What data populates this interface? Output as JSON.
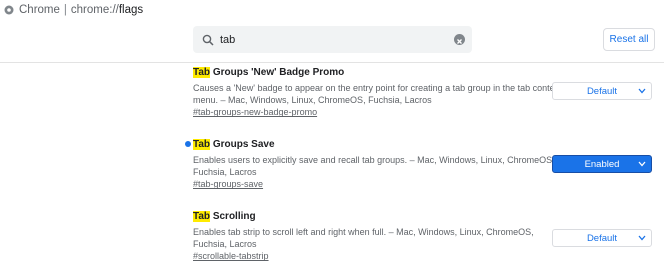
{
  "addressbar": {
    "browser": "Chrome",
    "separator": "|",
    "url_scheme": "chrome://",
    "url_path": "flags"
  },
  "search": {
    "value": "tab"
  },
  "reset_all_label": "Reset all",
  "flags": [
    {
      "highlight": "Tab",
      "title_rest": " Groups 'New' Badge Promo",
      "description": "Causes a 'New' badge to appear on the entry point for creating a tab group in the tab context menu. – Mac, Windows, Linux, ChromeOS, Fuchsia, Lacros",
      "link": "#tab-groups-new-badge-promo",
      "state": "Default"
    },
    {
      "highlight": "Tab",
      "title_rest": " Groups Save",
      "description": "Enables users to explicitly save and recall tab groups. – Mac, Windows, Linux, ChromeOS, Fuchsia, Lacros",
      "link": "#tab-groups-save",
      "state": "Enabled"
    },
    {
      "highlight": "Tab",
      "title_rest": " Scrolling",
      "description": "Enables tab strip to scroll left and right when full. – Mac, Windows, Linux, ChromeOS, Fuchsia, Lacros",
      "link": "#scrollable-tabstrip",
      "state": "Default"
    }
  ],
  "colors": {
    "accent": "#1a73e8",
    "highlight": "#ffeb00",
    "text_secondary": "#5f6368"
  }
}
